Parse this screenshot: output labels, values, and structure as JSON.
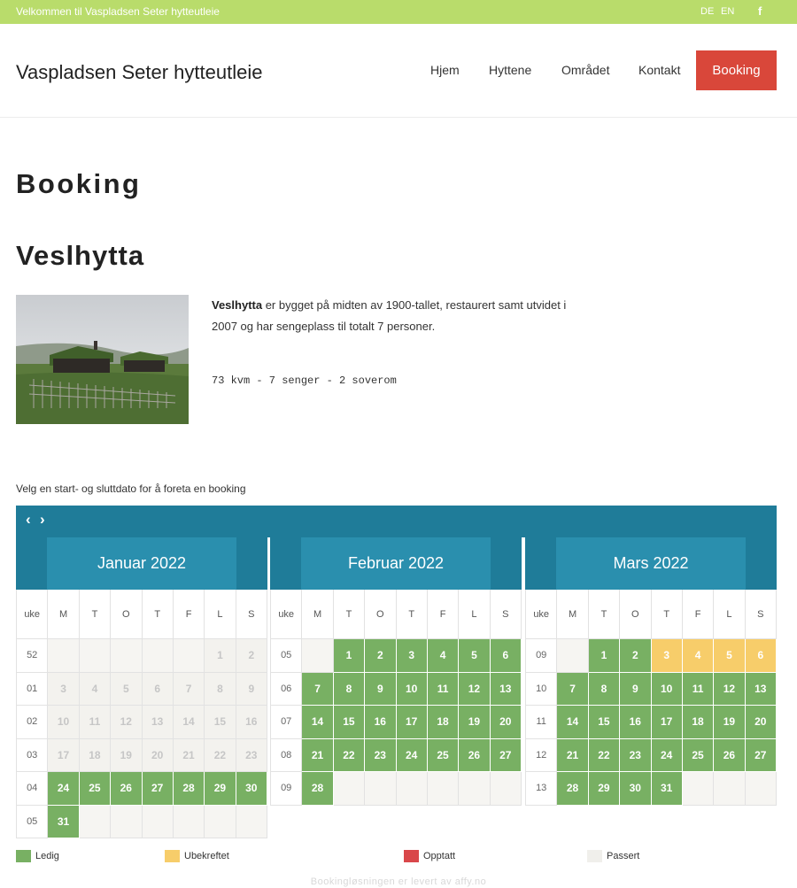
{
  "topbar": {
    "welcome": "Velkommen til Vaspladsen Seter hytteutleie",
    "lang_de": "DE",
    "lang_en": "EN",
    "facebook_glyph": "f",
    "facebook_icon": "facebook-icon"
  },
  "header": {
    "site_title": "Vaspladsen Seter hytteutleie",
    "nav": {
      "home": "Hjem",
      "cabins": "Hyttene",
      "area": "Området",
      "contact": "Kontakt",
      "booking": "Booking"
    }
  },
  "page": {
    "title": "Booking",
    "cabin_name": "Veslhytta",
    "description_name": "Veslhytta",
    "description_rest": " er bygget på midten av 1900-tallet, restaurert samt utvidet i 2007 og har sengeplass til totalt 7 personer.",
    "specs": "73 kvm - 7 senger - 2 soverom"
  },
  "calendar": {
    "instruction": "Velg en start- og sluttdato for å foreta en booking",
    "prev_glyph": "‹",
    "next_glyph": "›",
    "headers": [
      "uke",
      "M",
      "T",
      "O",
      "T",
      "F",
      "L",
      "S"
    ],
    "months": [
      {
        "name": "Januar 2022",
        "weeks": [
          {
            "week": "52",
            "days": [
              [
                "",
                "empty"
              ],
              [
                "",
                "empty"
              ],
              [
                "",
                "empty"
              ],
              [
                "",
                "empty"
              ],
              [
                "",
                "empty"
              ],
              [
                "1",
                "past"
              ],
              [
                "2",
                "past"
              ]
            ]
          },
          {
            "week": "01",
            "days": [
              [
                "3",
                "past"
              ],
              [
                "4",
                "past"
              ],
              [
                "5",
                "past"
              ],
              [
                "6",
                "past"
              ],
              [
                "7",
                "past"
              ],
              [
                "8",
                "past"
              ],
              [
                "9",
                "past"
              ]
            ]
          },
          {
            "week": "02",
            "days": [
              [
                "10",
                "past"
              ],
              [
                "11",
                "past"
              ],
              [
                "12",
                "past"
              ],
              [
                "13",
                "past"
              ],
              [
                "14",
                "past"
              ],
              [
                "15",
                "past"
              ],
              [
                "16",
                "past"
              ]
            ]
          },
          {
            "week": "03",
            "days": [
              [
                "17",
                "past"
              ],
              [
                "18",
                "past"
              ],
              [
                "19",
                "past"
              ],
              [
                "20",
                "past"
              ],
              [
                "21",
                "past"
              ],
              [
                "22",
                "past"
              ],
              [
                "23",
                "past"
              ]
            ]
          },
          {
            "week": "04",
            "days": [
              [
                "24",
                "free"
              ],
              [
                "25",
                "free"
              ],
              [
                "26",
                "free"
              ],
              [
                "27",
                "free"
              ],
              [
                "28",
                "free"
              ],
              [
                "29",
                "free"
              ],
              [
                "30",
                "free"
              ]
            ]
          },
          {
            "week": "05",
            "days": [
              [
                "31",
                "free"
              ],
              [
                "",
                "empty"
              ],
              [
                "",
                "empty"
              ],
              [
                "",
                "empty"
              ],
              [
                "",
                "empty"
              ],
              [
                "",
                "empty"
              ],
              [
                "",
                "empty"
              ]
            ]
          }
        ]
      },
      {
        "name": "Februar 2022",
        "weeks": [
          {
            "week": "05",
            "days": [
              [
                "",
                "empty"
              ],
              [
                "1",
                "free"
              ],
              [
                "2",
                "free"
              ],
              [
                "3",
                "free"
              ],
              [
                "4",
                "free"
              ],
              [
                "5",
                "free"
              ],
              [
                "6",
                "free"
              ]
            ]
          },
          {
            "week": "06",
            "days": [
              [
                "7",
                "free"
              ],
              [
                "8",
                "free"
              ],
              [
                "9",
                "free"
              ],
              [
                "10",
                "free"
              ],
              [
                "11",
                "free"
              ],
              [
                "12",
                "free"
              ],
              [
                "13",
                "free"
              ]
            ]
          },
          {
            "week": "07",
            "days": [
              [
                "14",
                "free"
              ],
              [
                "15",
                "free"
              ],
              [
                "16",
                "free"
              ],
              [
                "17",
                "free"
              ],
              [
                "18",
                "free"
              ],
              [
                "19",
                "free"
              ],
              [
                "20",
                "free"
              ]
            ]
          },
          {
            "week": "08",
            "days": [
              [
                "21",
                "free"
              ],
              [
                "22",
                "free"
              ],
              [
                "23",
                "free"
              ],
              [
                "24",
                "free"
              ],
              [
                "25",
                "free"
              ],
              [
                "26",
                "free"
              ],
              [
                "27",
                "free"
              ]
            ]
          },
          {
            "week": "09",
            "days": [
              [
                "28",
                "free"
              ],
              [
                "",
                "empty"
              ],
              [
                "",
                "empty"
              ],
              [
                "",
                "empty"
              ],
              [
                "",
                "empty"
              ],
              [
                "",
                "empty"
              ],
              [
                "",
                "empty"
              ]
            ]
          }
        ]
      },
      {
        "name": "Mars 2022",
        "weeks": [
          {
            "week": "09",
            "days": [
              [
                "",
                "empty"
              ],
              [
                "1",
                "free"
              ],
              [
                "2",
                "free"
              ],
              [
                "3",
                "pending"
              ],
              [
                "4",
                "pending"
              ],
              [
                "5",
                "pending"
              ],
              [
                "6",
                "pending"
              ]
            ]
          },
          {
            "week": "10",
            "days": [
              [
                "7",
                "free"
              ],
              [
                "8",
                "free"
              ],
              [
                "9",
                "free"
              ],
              [
                "10",
                "free"
              ],
              [
                "11",
                "free"
              ],
              [
                "12",
                "free"
              ],
              [
                "13",
                "free"
              ]
            ]
          },
          {
            "week": "11",
            "days": [
              [
                "14",
                "free"
              ],
              [
                "15",
                "free"
              ],
              [
                "16",
                "free"
              ],
              [
                "17",
                "free"
              ],
              [
                "18",
                "free"
              ],
              [
                "19",
                "free"
              ],
              [
                "20",
                "free"
              ]
            ]
          },
          {
            "week": "12",
            "days": [
              [
                "21",
                "free"
              ],
              [
                "22",
                "free"
              ],
              [
                "23",
                "free"
              ],
              [
                "24",
                "free"
              ],
              [
                "25",
                "free"
              ],
              [
                "26",
                "free"
              ],
              [
                "27",
                "free"
              ]
            ]
          },
          {
            "week": "13",
            "days": [
              [
                "28",
                "free"
              ],
              [
                "29",
                "free"
              ],
              [
                "30",
                "free"
              ],
              [
                "31",
                "free"
              ],
              [
                "",
                "empty"
              ],
              [
                "",
                "empty"
              ],
              [
                "",
                "empty"
              ]
            ]
          }
        ]
      }
    ]
  },
  "legend": {
    "free": "Ledig",
    "pending": "Ubekreftet",
    "booked": "Opptatt",
    "past": "Passert"
  },
  "colors": {
    "topbar": "#b9dc6b",
    "accent": "#d9473a",
    "calendar": "#1f7c99",
    "free": "#78b063",
    "pending": "#f7cd6a",
    "booked": "#d9474a",
    "past": "#f0efeb"
  },
  "footer": "Bookingløsningen er levert av affy.no"
}
